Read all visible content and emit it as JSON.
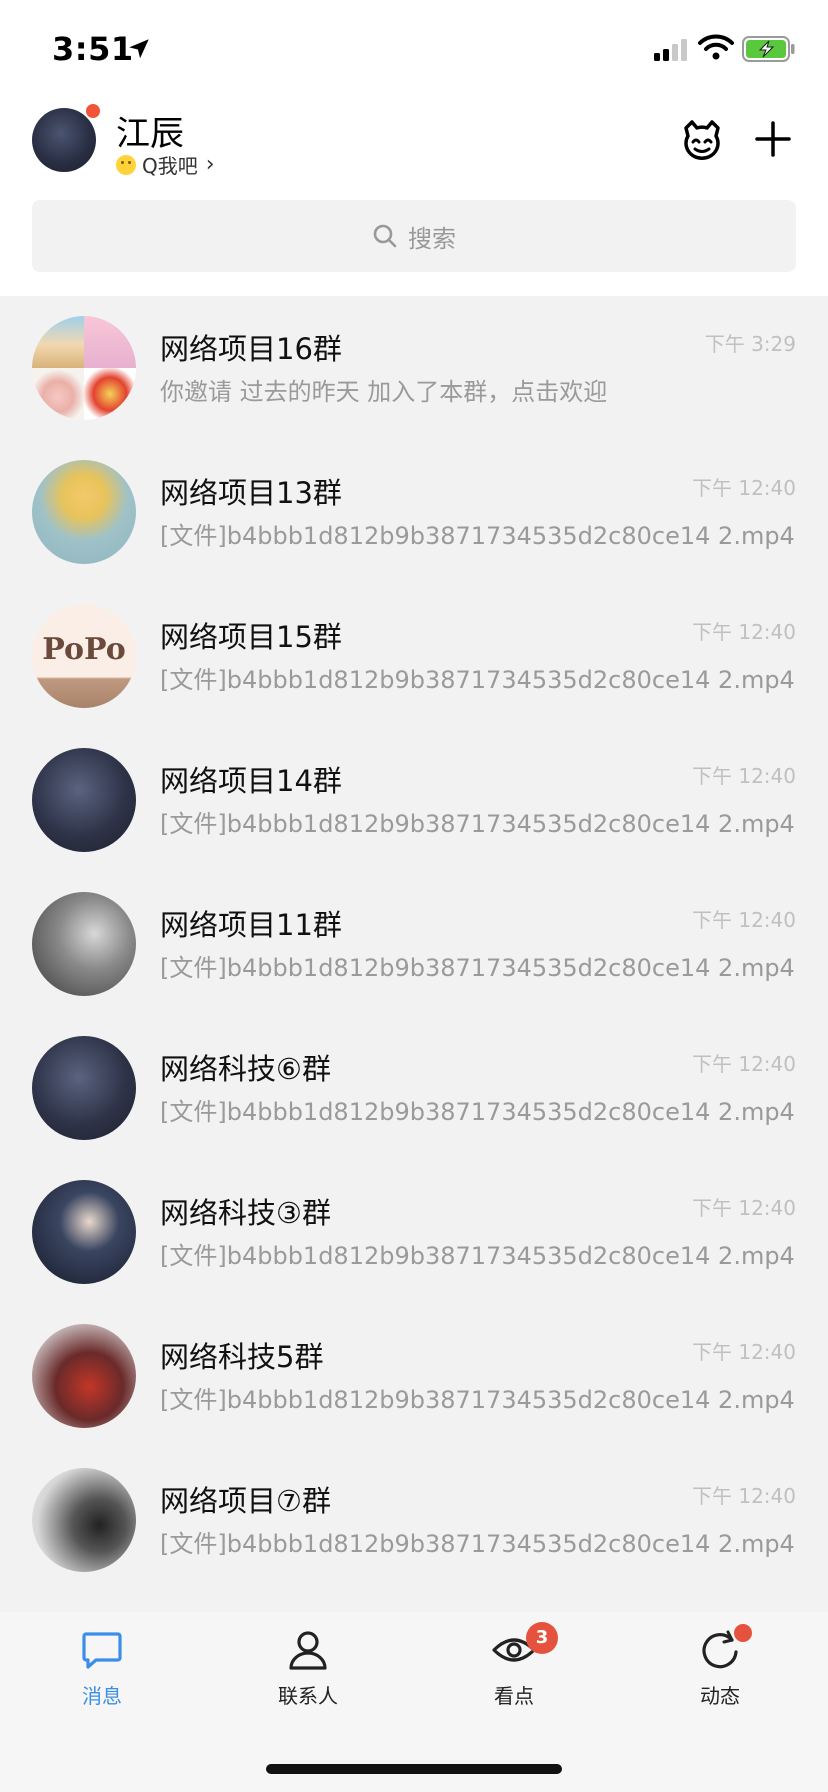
{
  "status_bar": {
    "time": "3:51"
  },
  "header": {
    "user_name": "江辰",
    "user_status": "Q我吧",
    "search_placeholder": "搜索"
  },
  "chats": [
    {
      "title": "网络项目16群",
      "preview": "你邀请 过去的昨天  加入了本群，点击欢迎",
      "time": "下午 3:29"
    },
    {
      "title": "网络项目13群",
      "preview": "[文件]b4bbb1d812b9b3871734535d2c80ce14 2.mp4",
      "time": "下午 12:40"
    },
    {
      "title": "网络项目15群",
      "preview": "[文件]b4bbb1d812b9b3871734535d2c80ce14 2.mp4",
      "time": "下午 12:40"
    },
    {
      "title": "网络项目14群",
      "preview": "[文件]b4bbb1d812b9b3871734535d2c80ce14 2.mp4",
      "time": "下午 12:40"
    },
    {
      "title": "网络项目11群",
      "preview": "[文件]b4bbb1d812b9b3871734535d2c80ce14 2.mp4",
      "time": "下午 12:40"
    },
    {
      "title": "网络科技⑥群",
      "preview": "[文件]b4bbb1d812b9b3871734535d2c80ce14 2.mp4",
      "time": "下午 12:40"
    },
    {
      "title": "网络科技③群",
      "preview": "[文件]b4bbb1d812b9b3871734535d2c80ce14 2.mp4",
      "time": "下午 12:40"
    },
    {
      "title": "网络科技5群",
      "preview": "[文件]b4bbb1d812b9b3871734535d2c80ce14 2.mp4",
      "time": "下午 12:40"
    },
    {
      "title": "网络项目⑦群",
      "preview": "[文件]b4bbb1d812b9b3871734535d2c80ce14 2.mp4",
      "time": "下午 12:40"
    }
  ],
  "tabs": [
    {
      "label": "消息",
      "icon": "chat-bubble-icon",
      "active": true
    },
    {
      "label": "联系人",
      "icon": "person-icon"
    },
    {
      "label": "看点",
      "icon": "eye-icon",
      "badge": "3"
    },
    {
      "label": "动态",
      "icon": "refresh-star-icon"
    }
  ],
  "colors": {
    "accent": "#3b8ee8",
    "badge": "#e5533e",
    "list_background": "#f2f2f2",
    "battery": "#5ac83c"
  }
}
